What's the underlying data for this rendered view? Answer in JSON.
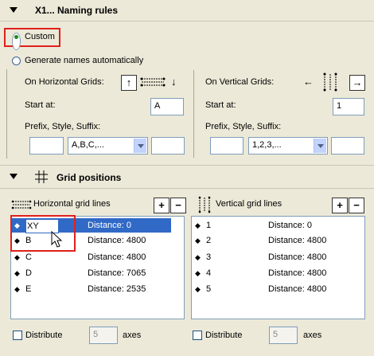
{
  "naming": {
    "title": "X1... Naming rules",
    "custom_label": "Custom",
    "auto_label": "Generate names automatically",
    "horizontal": {
      "label": "On Horizontal Grids:",
      "start_label": "Start at:",
      "start_value": "A",
      "psuffix_label": "Prefix, Style, Suffix:",
      "style_value": "A,B,C,..."
    },
    "vertical": {
      "label": "On Vertical Grids:",
      "start_label": "Start at:",
      "start_value": "1",
      "psuffix_label": "Prefix, Style, Suffix:",
      "style_value": "1,2,3,..."
    }
  },
  "positions": {
    "title": "Grid positions",
    "horizontal": {
      "label": "Horizontal grid lines",
      "rows": [
        {
          "name": "XY",
          "distance": "Distance: 0"
        },
        {
          "name": "B",
          "distance": "Distance: 4800"
        },
        {
          "name": "C",
          "distance": "Distance: 4800"
        },
        {
          "name": "D",
          "distance": "Distance: 7065"
        },
        {
          "name": "E",
          "distance": "Distance: 2535"
        }
      ],
      "distribute_label": "Distribute",
      "axes_value": "5",
      "axes_label": "axes"
    },
    "vertical": {
      "label": "Vertical grid lines",
      "rows": [
        {
          "name": "1",
          "distance": "Distance: 0"
        },
        {
          "name": "2",
          "distance": "Distance: 4800"
        },
        {
          "name": "3",
          "distance": "Distance: 4800"
        },
        {
          "name": "4",
          "distance": "Distance: 4800"
        },
        {
          "name": "5",
          "distance": "Distance: 4800"
        }
      ],
      "distribute_label": "Distribute",
      "axes_value": "5",
      "axes_label": "axes"
    },
    "add_symbol": "+",
    "remove_symbol": "−"
  },
  "colors": {
    "highlight": "#e0201b",
    "selection": "#3169c6",
    "background": "#ece9d8"
  },
  "icons": [
    "collapse-triangle-icon",
    "grid-positions-icon",
    "arrow-up-icon",
    "arrow-down-icon",
    "arrow-left-icon",
    "arrow-right-icon",
    "horizontal-grid-icon",
    "vertical-grid-icon",
    "reorder-arrows-icon",
    "mouse-cursor-icon"
  ]
}
